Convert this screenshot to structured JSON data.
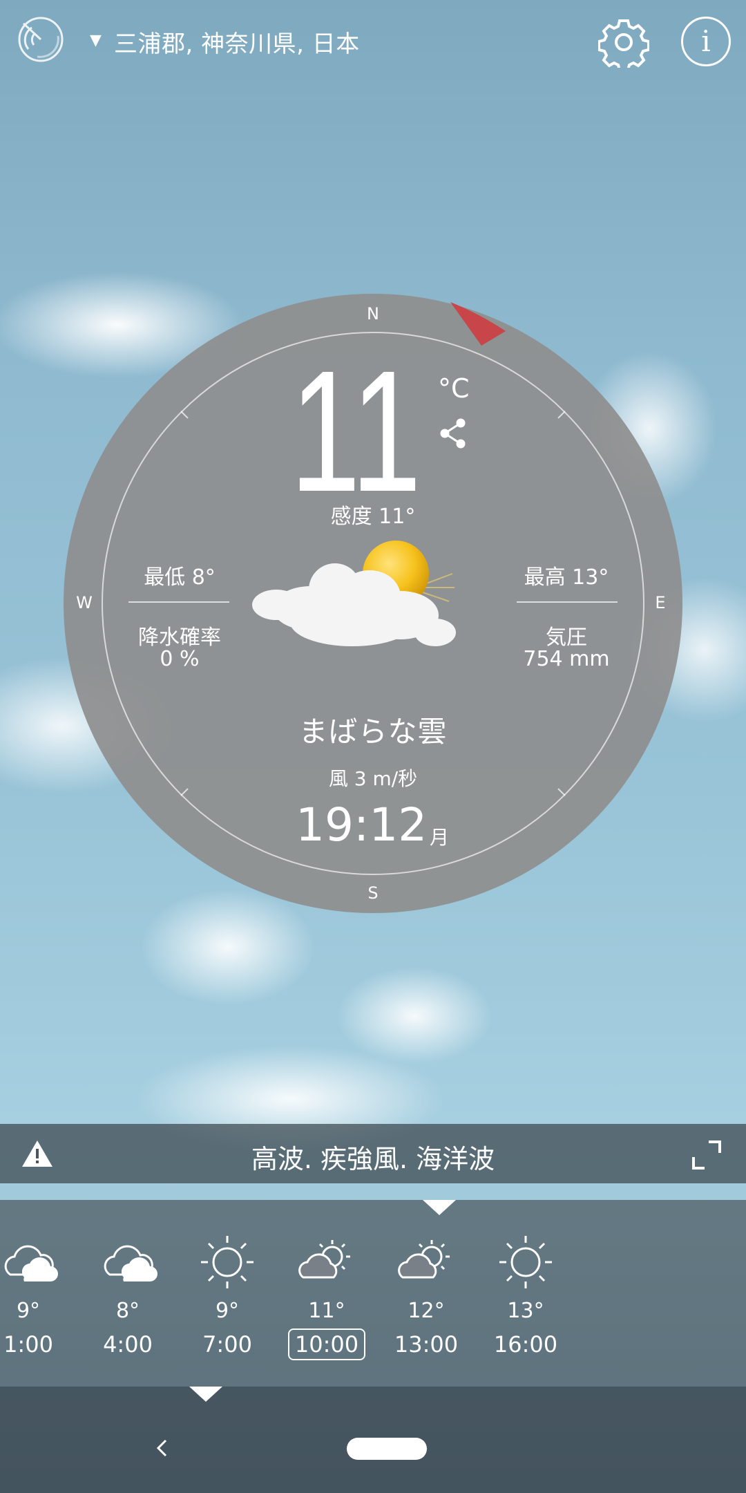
{
  "header": {
    "location": "三浦郡, 神奈川県, 日本",
    "icons": [
      "radar-icon",
      "dropdown-triangle-icon",
      "gear-icon",
      "info-icon"
    ]
  },
  "current": {
    "temperature": "11",
    "unit": "°C",
    "feels_like": "感度 11°",
    "low": "最低 8°",
    "high": "最高 13°",
    "precip_label": "降水確率",
    "precip_value": "0 %",
    "pressure_label": "気圧",
    "pressure_value": "754 mm",
    "condition": "まばらな雲",
    "wind": "風 3 m/秒",
    "time": "19:12",
    "day": "月"
  },
  "compass": {
    "n": "N",
    "s": "S",
    "e": "E",
    "w": "W"
  },
  "colors": {
    "wind_marker": "#c8454a",
    "dial_fill": "#8e8e8e"
  },
  "alert": {
    "text": "高波. 疾強風. 海洋波"
  },
  "forecast": [
    {
      "temp": "9°",
      "time": "1:00",
      "icon": "cloud-icon",
      "selected": false
    },
    {
      "temp": "8°",
      "time": "4:00",
      "icon": "cloud-icon",
      "selected": false
    },
    {
      "temp": "9°",
      "time": "7:00",
      "icon": "sun-icon",
      "selected": false
    },
    {
      "temp": "11°",
      "time": "10:00",
      "icon": "partly-cloudy-icon",
      "selected": true
    },
    {
      "temp": "12°",
      "time": "13:00",
      "icon": "partly-cloudy-icon",
      "selected": false
    },
    {
      "temp": "13°",
      "time": "16:00",
      "icon": "sun-icon",
      "selected": false
    }
  ]
}
